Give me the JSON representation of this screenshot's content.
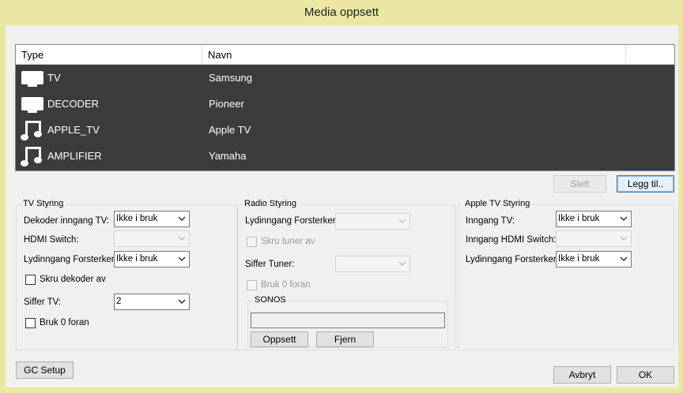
{
  "window": {
    "title": "Media oppsett"
  },
  "list": {
    "columns": [
      "Type",
      "Navn"
    ],
    "rows": [
      {
        "icon": "tv-icon",
        "type": "TV",
        "name": "Samsung"
      },
      {
        "icon": "tv-icon",
        "type": "DECODER",
        "name": "Pioneer"
      },
      {
        "icon": "music-note-icon",
        "type": "APPLE_TV",
        "name": "Apple TV"
      },
      {
        "icon": "music-note-icon",
        "type": "AMPLIFIER",
        "name": "Yamaha"
      }
    ]
  },
  "buttons": {
    "delete": "Slett",
    "add": "Legg til..",
    "gc_setup": "GC Setup",
    "cancel": "Avbryt",
    "ok": "OK",
    "sonos_setup": "Oppsett",
    "sonos_remove": "Fjern"
  },
  "tv_group": {
    "title": "TV Styring",
    "decoder_input_label": "Dekoder inngang TV:",
    "decoder_input_value": "Ikke i bruk",
    "hdmi_switch_label": "HDMI Switch:",
    "hdmi_switch_value": "",
    "sound_input_label": "Lydinngang Forsterker:",
    "sound_input_value": "Ikke i bruk",
    "turn_off_decoder_label": "Skru dekoder av",
    "digits_label": "Siffer TV:",
    "digits_value": "2",
    "use_zero_label": "Bruk 0 foran"
  },
  "radio_group": {
    "title": "Radio Styring",
    "sound_input_label": "Lydinngang Forsterker:",
    "sound_input_value": "",
    "turn_off_tuner_label": "Skru tuner av",
    "digits_label": "Siffer Tuner:",
    "digits_value": "",
    "use_zero_label": "Bruk 0 foran",
    "sonos_title": "SONOS",
    "sonos_value": ""
  },
  "apple_group": {
    "title": "Apple TV Styring",
    "input_tv_label": "Inngang TV:",
    "input_tv_value": "Ikke i bruk",
    "hdmi_switch_label": "Inngang HDMI Switch:",
    "hdmi_switch_value": "",
    "sound_input_label": "Lydinngang Forsterker:",
    "sound_input_value": "Ikke i bruk"
  }
}
